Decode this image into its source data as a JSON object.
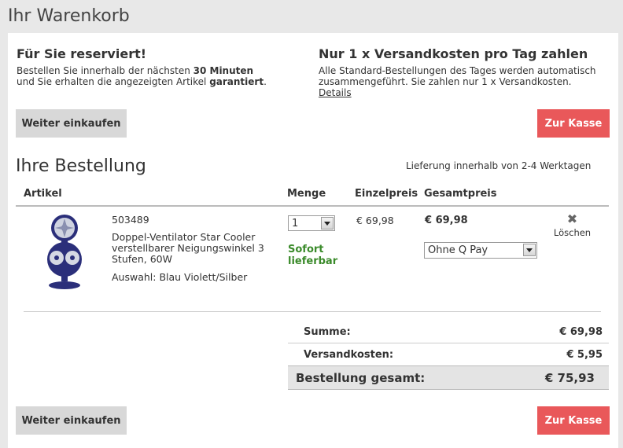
{
  "page": {
    "title": "Ihr Warenkorb"
  },
  "reserved": {
    "title": "Für Sie reserviert!",
    "line1_a": "Bestellen Sie innerhalb der nächsten ",
    "line1_b": "30 Minuten",
    "line2_a": "und Sie erhalten die angezeigten Artikel ",
    "line2_b": "garantiert",
    "line2_c": "."
  },
  "shipping_info": {
    "title": "Nur 1 x Versandkosten pro Tag zahlen",
    "line1": "Alle Standard-Bestellungen des Tages werden automatisch",
    "line2": "zusammengeführt. Sie zahlen nur 1 x Versandkosten.",
    "details_link": "Details"
  },
  "buttons": {
    "continue_shopping": "Weiter einkaufen",
    "checkout": "Zur Kasse"
  },
  "order": {
    "title": "Ihre Bestellung",
    "delivery_note": "Lieferung innerhalb von 2-4 Werktagen",
    "columns": {
      "article": "Artikel",
      "quantity": "Menge",
      "unit_price": "Einzelpreis",
      "total_price": "Gesamtpreis"
    },
    "item": {
      "number": "503489",
      "name_line1": "Doppel-Ventilator Star Cooler",
      "name_line2": "verstellbarer Neigungswinkel 3",
      "name_line3": "Stufen, 60W",
      "selection": "Auswahl: Blau Violett/Silber",
      "quantity": "1",
      "availability_line1": "Sofort",
      "availability_line2": "lieferbar",
      "unit_price": "€ 69,98",
      "total_price": "€ 69,98",
      "payment_option": "Ohne Q Pay",
      "delete_label": "Löschen"
    }
  },
  "summary": {
    "subtotal_label": "Summe:",
    "subtotal_value": "€ 69,98",
    "shipping_label": "Versandkosten:",
    "shipping_value": "€ 5,95",
    "total_label": "Bestellung gesamt:",
    "total_value": "€ 75,93"
  },
  "colors": {
    "accent_red": "#e9585a",
    "availability_green": "#3a8a2a",
    "product_blue": "#2b2f7a"
  }
}
